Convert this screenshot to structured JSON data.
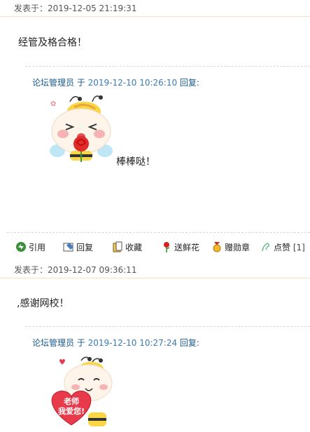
{
  "posts": [
    {
      "meta": "发表于：2019-12-05 21:19:31",
      "body": "经管及格合格！",
      "reply": {
        "author": "论坛管理员",
        "sep": " 于 ",
        "time": "2019-12-10 10:26:10",
        "suffix": " 回复:",
        "text": "棒棒哒！"
      }
    },
    {
      "meta": "发表于：2019-12-07 09:36:11",
      "body": ",感谢网校！",
      "reply": {
        "author": "论坛管理员",
        "sep": " 于 ",
        "time": "2019-12-10 10:27:24",
        "suffix": " 回复:",
        "sticker_text_1": "老师",
        "sticker_text_2": "我爱您!"
      }
    }
  ],
  "actions": {
    "quote": "引用",
    "reply": "回复",
    "favorite": "收藏",
    "flowers": "送鲜花",
    "medal": "赠勋章",
    "like": "点赞",
    "like_count": "[1]"
  },
  "colors": {
    "link_blue": "#1a5a8c",
    "meta_border": "#f0e4bf",
    "bee_yellow": "#f9d645",
    "heart_red": "#e83a4a"
  }
}
